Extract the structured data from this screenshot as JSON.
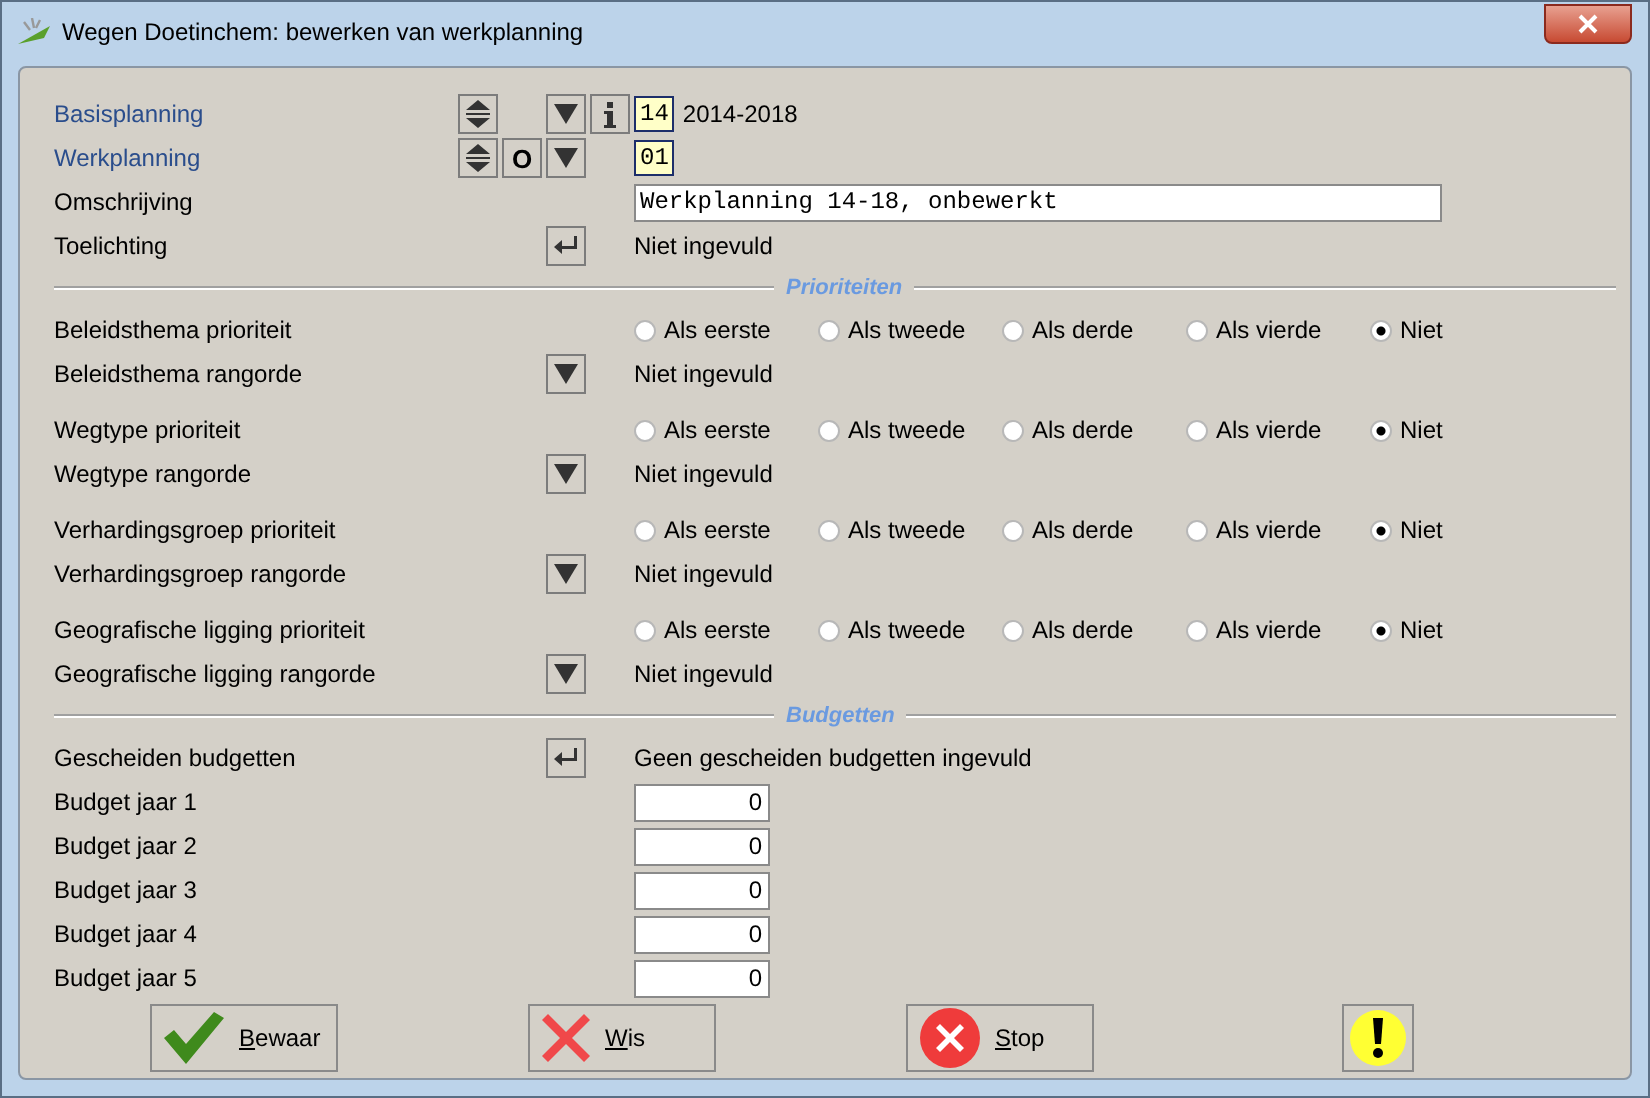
{
  "window": {
    "title": "Wegen Doetinchem: bewerken van werkplanning"
  },
  "header_rows": [
    {
      "kind": "code",
      "label": "Basisplanning",
      "linked": true,
      "spin": true,
      "dropdown": true,
      "info": true,
      "code": "14",
      "text": "2014-2018"
    },
    {
      "kind": "code",
      "label": "Werkplanning",
      "linked": true,
      "spin": true,
      "letter": "O",
      "dropdown": true,
      "code": "01"
    },
    {
      "kind": "input",
      "label": "Omschrijving",
      "linked": false,
      "value": "Werkplanning 14-18, onbewerkt"
    },
    {
      "kind": "text",
      "label": "Toelichting",
      "linked": false,
      "enter": true,
      "text": "Niet ingevuld"
    }
  ],
  "priorities": {
    "legend": "Prioriteiten",
    "groups": [
      {
        "priority_label": "Beleidsthema prioriteit",
        "options": [
          {
            "label": "Als eerste",
            "selected": false
          },
          {
            "label": "Als tweede",
            "selected": false
          },
          {
            "label": "Als derde",
            "selected": false
          },
          {
            "label": "Als vierde",
            "selected": false
          },
          {
            "label": "Niet",
            "selected": true
          }
        ],
        "order_label": "Beleidsthema rangorde",
        "order_value": "Niet ingevuld"
      },
      {
        "priority_label": "Wegtype prioriteit",
        "options": [
          {
            "label": "Als eerste",
            "selected": false
          },
          {
            "label": "Als tweede",
            "selected": false
          },
          {
            "label": "Als derde",
            "selected": false
          },
          {
            "label": "Als vierde",
            "selected": false
          },
          {
            "label": "Niet",
            "selected": true
          }
        ],
        "order_label": "Wegtype rangorde",
        "order_value": "Niet ingevuld"
      },
      {
        "priority_label": "Verhardingsgroep prioriteit",
        "options": [
          {
            "label": "Als eerste",
            "selected": false
          },
          {
            "label": "Als tweede",
            "selected": false
          },
          {
            "label": "Als derde",
            "selected": false
          },
          {
            "label": "Als vierde",
            "selected": false
          },
          {
            "label": "Niet",
            "selected": true
          }
        ],
        "order_label": "Verhardingsgroep rangorde",
        "order_value": "Niet ingevuld"
      },
      {
        "priority_label": "Geografische ligging prioriteit",
        "options": [
          {
            "label": "Als eerste",
            "selected": false
          },
          {
            "label": "Als tweede",
            "selected": false
          },
          {
            "label": "Als derde",
            "selected": false
          },
          {
            "label": "Als vierde",
            "selected": false
          },
          {
            "label": "Niet",
            "selected": true
          }
        ],
        "order_label": "Geografische ligging rangorde",
        "order_value": "Niet ingevuld"
      }
    ]
  },
  "budgets": {
    "legend": "Budgetten",
    "separate_label": "Gescheiden budgetten",
    "separate_value": "Geen gescheiden budgetten ingevuld",
    "years": [
      {
        "label": "Budget jaar 1",
        "value": "0"
      },
      {
        "label": "Budget jaar 2",
        "value": "0"
      },
      {
        "label": "Budget jaar 3",
        "value": "0"
      },
      {
        "label": "Budget jaar 4",
        "value": "0"
      },
      {
        "label": "Budget jaar 5",
        "value": "0"
      }
    ]
  },
  "actions": [
    {
      "kind": "save",
      "label": "Bewaar"
    },
    {
      "kind": "clear",
      "label": "Wis"
    },
    {
      "kind": "stop",
      "label": "Stop"
    },
    {
      "kind": "alert"
    }
  ]
}
